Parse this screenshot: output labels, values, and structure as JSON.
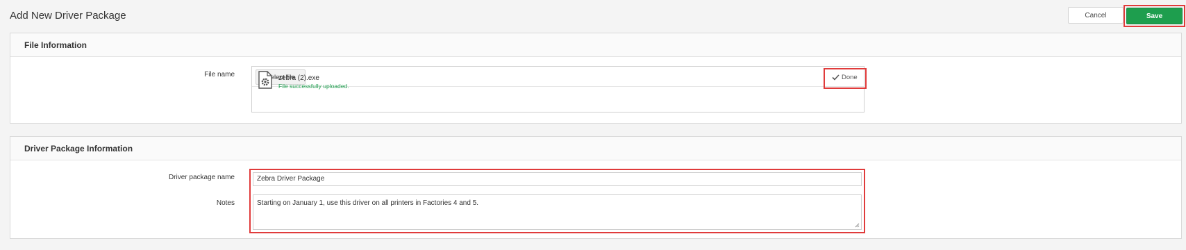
{
  "header": {
    "title": "Add New Driver Package",
    "cancel_label": "Cancel",
    "save_label": "Save"
  },
  "file_section": {
    "title": "File Information",
    "file_label": "File name",
    "select_label": "Select file",
    "done_label": "Done",
    "file": {
      "name": "zebra (2).exe",
      "status": "File successfully uploaded."
    }
  },
  "driver_section": {
    "title": "Driver Package Information",
    "name_label": "Driver package name",
    "name_value": "Zebra Driver Package",
    "notes_label": "Notes",
    "notes_value": "Starting on January 1, use this driver on all printers in Factories 4 and 5."
  },
  "colors": {
    "save": "#1e9e4e",
    "highlight": "#e03b3b",
    "success_text": "#1e9e4e"
  },
  "icons": {
    "done": "checkmark-icon",
    "file": "file-gear-icon"
  }
}
